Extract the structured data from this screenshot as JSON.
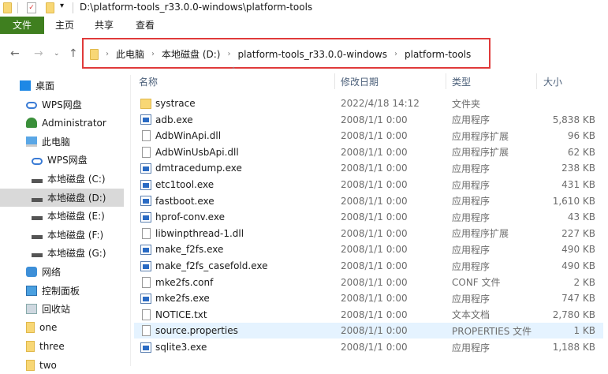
{
  "title": {
    "path": "D:\\platform-tools_r33.0.0-windows\\platform-tools"
  },
  "ribbon": {
    "tabs": [
      "文件",
      "主页",
      "共享",
      "查看"
    ]
  },
  "address": {
    "crumbs": [
      "此电脑",
      "本地磁盘 (D:)",
      "platform-tools_r33.0.0-windows",
      "platform-tools"
    ]
  },
  "nav": [
    {
      "label": "桌面",
      "icon": "desktop-icon"
    },
    {
      "label": "WPS网盘",
      "icon": "cloud-icon"
    },
    {
      "label": "Administrator",
      "icon": "user-icon"
    },
    {
      "label": "此电脑",
      "icon": "computer-icon"
    },
    {
      "label": "WPS网盘",
      "icon": "cloud-icon"
    },
    {
      "label": "本地磁盘 (C:)",
      "icon": "drive-icon"
    },
    {
      "label": "本地磁盘 (D:)",
      "icon": "drive-icon",
      "selected": true
    },
    {
      "label": "本地磁盘 (E:)",
      "icon": "drive-icon"
    },
    {
      "label": "本地磁盘 (F:)",
      "icon": "drive-icon"
    },
    {
      "label": "本地磁盘 (G:)",
      "icon": "drive-icon"
    },
    {
      "label": "网络",
      "icon": "network-icon"
    },
    {
      "label": "控制面板",
      "icon": "control-panel-icon"
    },
    {
      "label": "回收站",
      "icon": "recycle-bin-icon"
    },
    {
      "label": "one",
      "icon": "folder-icon"
    },
    {
      "label": "three",
      "icon": "folder-icon"
    },
    {
      "label": "two",
      "icon": "folder-icon"
    }
  ],
  "columns": {
    "name": "名称",
    "date": "修改日期",
    "type": "类型",
    "size": "大小"
  },
  "files": [
    {
      "name": "systrace",
      "date": "2022/4/18 14:12",
      "type": "文件夹",
      "size": "",
      "kind": "folder"
    },
    {
      "name": "adb.exe",
      "date": "2008/1/1 0:00",
      "type": "应用程序",
      "size": "5,838 KB",
      "kind": "exe"
    },
    {
      "name": "AdbWinApi.dll",
      "date": "2008/1/1 0:00",
      "type": "应用程序扩展",
      "size": "96 KB",
      "kind": "dll"
    },
    {
      "name": "AdbWinUsbApi.dll",
      "date": "2008/1/1 0:00",
      "type": "应用程序扩展",
      "size": "62 KB",
      "kind": "dll"
    },
    {
      "name": "dmtracedump.exe",
      "date": "2008/1/1 0:00",
      "type": "应用程序",
      "size": "238 KB",
      "kind": "exe"
    },
    {
      "name": "etc1tool.exe",
      "date": "2008/1/1 0:00",
      "type": "应用程序",
      "size": "431 KB",
      "kind": "exe"
    },
    {
      "name": "fastboot.exe",
      "date": "2008/1/1 0:00",
      "type": "应用程序",
      "size": "1,610 KB",
      "kind": "exe"
    },
    {
      "name": "hprof-conv.exe",
      "date": "2008/1/1 0:00",
      "type": "应用程序",
      "size": "43 KB",
      "kind": "exe"
    },
    {
      "name": "libwinpthread-1.dll",
      "date": "2008/1/1 0:00",
      "type": "应用程序扩展",
      "size": "227 KB",
      "kind": "dll"
    },
    {
      "name": "make_f2fs.exe",
      "date": "2008/1/1 0:00",
      "type": "应用程序",
      "size": "490 KB",
      "kind": "exe"
    },
    {
      "name": "make_f2fs_casefold.exe",
      "date": "2008/1/1 0:00",
      "type": "应用程序",
      "size": "490 KB",
      "kind": "exe"
    },
    {
      "name": "mke2fs.conf",
      "date": "2008/1/1 0:00",
      "type": "CONF 文件",
      "size": "2 KB",
      "kind": "doc"
    },
    {
      "name": "mke2fs.exe",
      "date": "2008/1/1 0:00",
      "type": "应用程序",
      "size": "747 KB",
      "kind": "exe"
    },
    {
      "name": "NOTICE.txt",
      "date": "2008/1/1 0:00",
      "type": "文本文档",
      "size": "2,780 KB",
      "kind": "doc"
    },
    {
      "name": "source.properties",
      "date": "2008/1/1 0:00",
      "type": "PROPERTIES 文件",
      "size": "1 KB",
      "kind": "doc",
      "highlighted": true
    },
    {
      "name": "sqlite3.exe",
      "date": "2008/1/1 0:00",
      "type": "应用程序",
      "size": "1,188 KB",
      "kind": "exe"
    }
  ]
}
